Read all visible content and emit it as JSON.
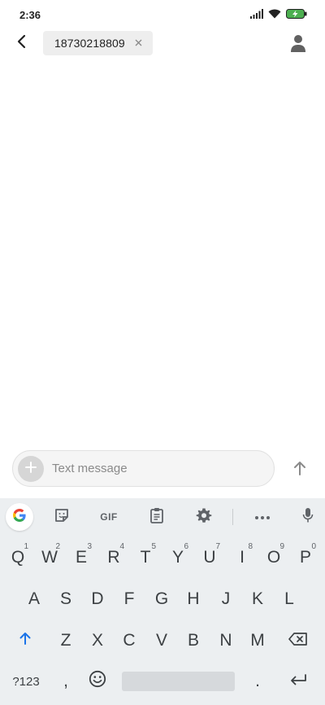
{
  "status_bar": {
    "time": "2:36"
  },
  "header": {
    "recipient": "18730218809"
  },
  "compose": {
    "placeholder": "Text message"
  },
  "keyboard": {
    "toolbar": {
      "gif_label": "GIF"
    },
    "row1": [
      {
        "label": "Q",
        "hint": "1"
      },
      {
        "label": "W",
        "hint": "2"
      },
      {
        "label": "E",
        "hint": "3"
      },
      {
        "label": "R",
        "hint": "4"
      },
      {
        "label": "T",
        "hint": "5"
      },
      {
        "label": "Y",
        "hint": "6"
      },
      {
        "label": "U",
        "hint": "7"
      },
      {
        "label": "I",
        "hint": "8"
      },
      {
        "label": "O",
        "hint": "9"
      },
      {
        "label": "P",
        "hint": "0"
      }
    ],
    "row2": [
      "A",
      "S",
      "D",
      "F",
      "G",
      "H",
      "J",
      "K",
      "L"
    ],
    "row3": [
      "Z",
      "X",
      "C",
      "V",
      "B",
      "N",
      "M"
    ],
    "symbols_label": "?123",
    "comma": ",",
    "period": "."
  },
  "colors": {
    "accent": "#1a73e8",
    "keyboard_bg": "#eceff1",
    "shift_active": "#1a73e8"
  }
}
